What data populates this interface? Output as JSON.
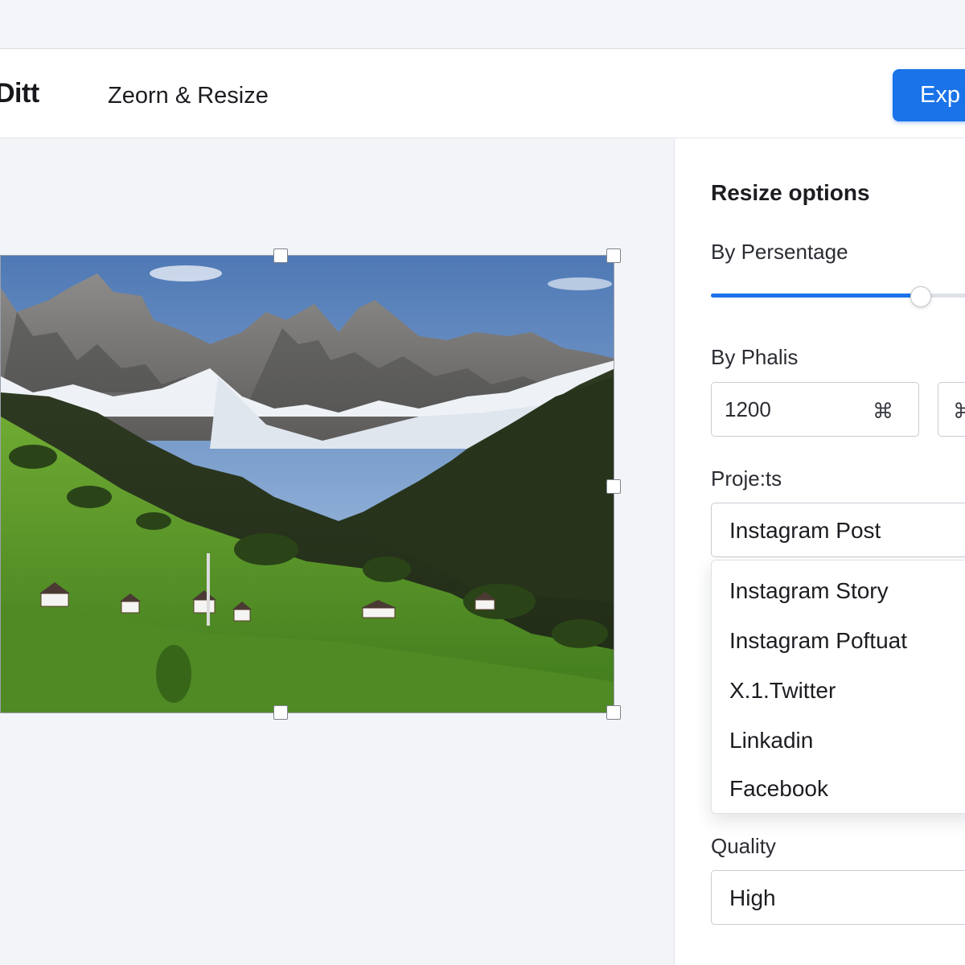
{
  "header": {
    "logo_text": "Ditt",
    "title": "Zeorn & Resize",
    "export_label": "Exp"
  },
  "canvas": {
    "image_subject": "mountain-valley-photo"
  },
  "panel": {
    "title": "Resize options",
    "percentage": {
      "label": "By Persentage",
      "value_fraction": 0.79
    },
    "pixels": {
      "label": "By Phalis",
      "width_value": "1200",
      "link_glyph": "⌘"
    },
    "presets": {
      "label": "Proje:ts",
      "selected": "Instagram Post",
      "options": [
        "Instagram Story",
        "Instagram Poftuat",
        "X.1.Twitter",
        "Linkadin",
        "Facebook"
      ]
    },
    "quality": {
      "label": "Quality",
      "selected": "High"
    }
  },
  "colors": {
    "accent": "#1a73e8",
    "background": "#f4f5f8",
    "panel": "#ffffff"
  }
}
